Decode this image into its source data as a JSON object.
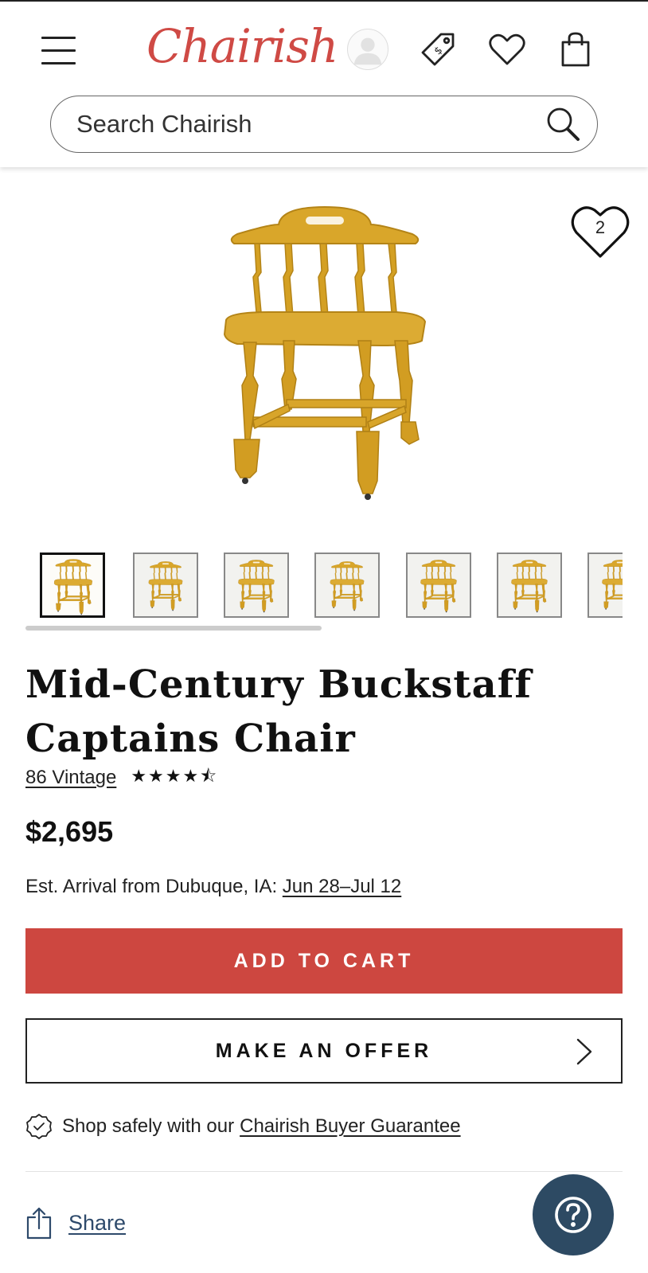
{
  "header": {
    "logo_text": "Chairish",
    "search": {
      "placeholder": "Search Chairish",
      "value": ""
    },
    "icons": [
      "menu-icon",
      "avatar",
      "price-tag-icon",
      "heart-icon",
      "shopping-bag-icon",
      "search-icon"
    ]
  },
  "product": {
    "image_alt": "Mid-Century Buckstaff Captains Chair",
    "favorite_count": "2",
    "title_line1": "Mid-Century Buckstaff",
    "title_line2": "Captains Chair",
    "seller": "86 Vintage",
    "rating_stars": "★★★★⯪",
    "rating_value": 4.5,
    "price": "$2,695",
    "arrival_label": "Est. Arrival from Dubuque, IA:",
    "arrival_dates": "Jun 28–Jul 12",
    "thumbnail_count": 7,
    "active_thumbnail": 1
  },
  "actions": {
    "add_to_cart": "ADD TO CART",
    "make_offer": "MAKE AN OFFER"
  },
  "guarantee": {
    "prefix": "Shop safely with our",
    "link": "Chairish Buyer Guarantee"
  },
  "share": {
    "label": "Share"
  },
  "colors": {
    "brand_red": "#cd4740",
    "chair_yellow": "#d9a62a",
    "help_blue": "#2d4a63",
    "share_link": "#2e4a6b"
  }
}
